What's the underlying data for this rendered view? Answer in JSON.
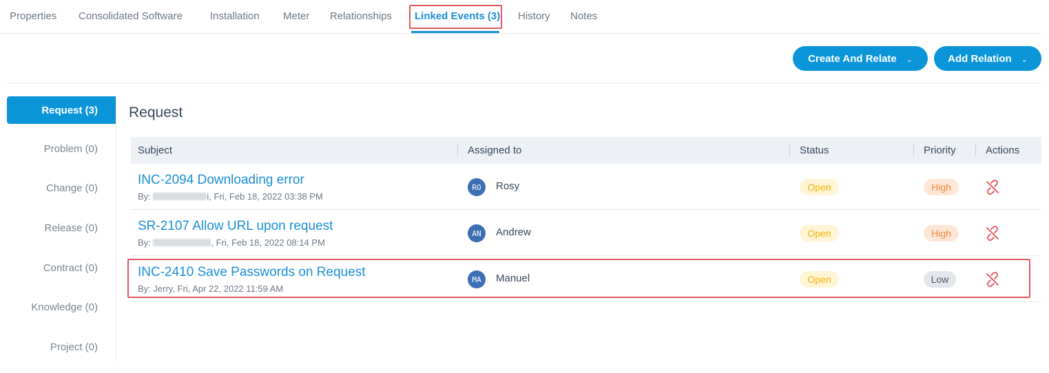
{
  "tabs": [
    {
      "label": "Properties"
    },
    {
      "label": "Consolidated Software"
    },
    {
      "label": "Installation"
    },
    {
      "label": "Meter"
    },
    {
      "label": "Relationships"
    },
    {
      "label": "Linked Events (3)"
    },
    {
      "label": "History"
    },
    {
      "label": "Notes"
    }
  ],
  "toolbar": {
    "create_label": "Create And Relate",
    "add_label": "Add Relation"
  },
  "sidebar": {
    "items": [
      {
        "label": "Request (3)"
      },
      {
        "label": "Problem (0)"
      },
      {
        "label": "Change (0)"
      },
      {
        "label": "Release (0)"
      },
      {
        "label": "Contract (0)"
      },
      {
        "label": "Knowledge (0)"
      },
      {
        "label": "Project (0)"
      }
    ]
  },
  "main": {
    "title": "Request",
    "columns": {
      "subject": "Subject",
      "assigned": "Assigned to",
      "status": "Status",
      "priority": "Priority",
      "actions": "Actions"
    },
    "rows": [
      {
        "subject": "INC-2094 Downloading error",
        "by_prefix": "By:",
        "by_suffix": "i, Fri, Feb 18, 2022 03:38 PM",
        "initials": "RO",
        "assignee": "Rosy",
        "status": "Open",
        "priority": "High"
      },
      {
        "subject": "SR-2107 Allow URL upon request",
        "by_prefix": "By:",
        "by_suffix": ", Fri, Feb 18, 2022 08:14 PM",
        "initials": "AN",
        "assignee": "Andrew",
        "status": "Open",
        "priority": "High"
      },
      {
        "subject": "INC-2410 Save Passwords on Request",
        "by_prefix": "By: Jerry, Fri, Apr 22, 2022 11:59 AM",
        "by_suffix": "",
        "initials": "MA",
        "assignee": "Manuel",
        "status": "Open",
        "priority": "Low"
      }
    ]
  },
  "colors": {
    "accent": "#0a95d9",
    "link": "#1a8ed6",
    "highlight": "#e05660",
    "unlink_icon": "#e8414a"
  }
}
